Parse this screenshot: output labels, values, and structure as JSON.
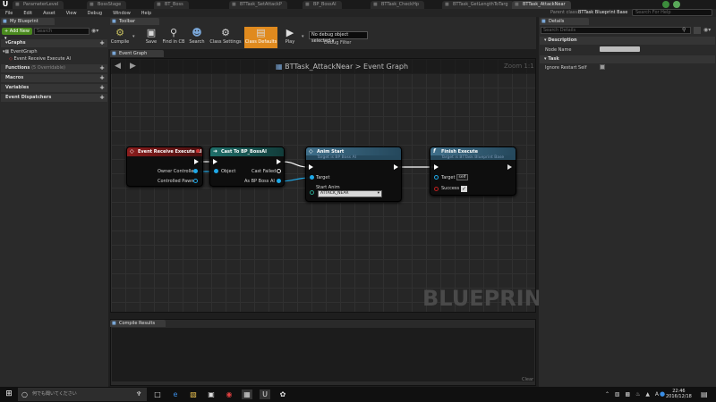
{
  "window": {
    "tabs": [
      "ParameterLevel",
      "BossStage",
      "BT_Boss",
      "BTTask_SetAttackP",
      "BP_BossAI",
      "BTTask_CheckHp",
      "BTTask_GetLengthToTarg",
      "BTTask_AttackNear"
    ],
    "parent_class_label": "Parent class:",
    "parent_class_value": "BTTask Blueprint Base",
    "help_search_placeholder": "Search For Help"
  },
  "menu": [
    "File",
    "Edit",
    "Asset",
    "View",
    "Debug",
    "Window",
    "Help"
  ],
  "my_blueprint": {
    "tab_label": "My Blueprint",
    "add_new_label": "Add New",
    "search_placeholder": "Search",
    "sections": {
      "graphs": "Graphs",
      "functions": "Functions",
      "functions_count": "(5 Overridable)",
      "macros": "Macros",
      "variables": "Variables",
      "event_dispatchers": "Event Dispatchers"
    },
    "tree": {
      "event_graph": "EventGraph",
      "event_receive": "Event Receive Execute AI"
    }
  },
  "toolbar": {
    "tab_label": "Toolbar",
    "compile": "Compile",
    "save": "Save",
    "find_in_cb": "Find in CB",
    "search": "Search",
    "class_settings": "Class Settings",
    "class_defaults": "Class Defaults",
    "play": "Play",
    "debug_selected": "No debug object selected",
    "debug_filter": "Debug Filter"
  },
  "graph": {
    "tab_label": "Event Graph",
    "path_asset": "BTTask_AttackNear",
    "path_sep": ">",
    "path_graph": "Event Graph",
    "zoom": "Zoom 1:1",
    "watermark": "BLUEPRINT"
  },
  "nodes": {
    "event": {
      "title": "Event Receive Execute AI",
      "pin_owner": "Owner Controller",
      "pin_pawn": "Controlled Pawn"
    },
    "cast": {
      "title": "Cast To BP_BossAI",
      "pin_object": "Object",
      "pin_failed": "Cast Failed",
      "pin_as": "As BP Boss AI"
    },
    "anim": {
      "title": "Anim Start",
      "subtitle": "Target is BP Boss AI",
      "pin_target": "Target",
      "pin_start_anim": "Start Anim",
      "start_anim_value": "ATTACK_NEAR"
    },
    "finish": {
      "title": "Finish Execute",
      "subtitle": "Target is BTTask Blueprint Base",
      "pin_target": "Target",
      "target_value": "self",
      "pin_success": "Success"
    }
  },
  "compile_results": {
    "tab_label": "Compile Results",
    "clear": "Clear"
  },
  "details": {
    "tab_label": "Details",
    "search_placeholder": "Search Details",
    "cat_description": "Description",
    "node_name_label": "Node Name",
    "cat_task": "Task",
    "ignore_restart_label": "Ignore Restart Self"
  },
  "taskbar": {
    "search_placeholder": "何でも聞いてください",
    "time": "22:46",
    "date": "2016/12/18"
  }
}
